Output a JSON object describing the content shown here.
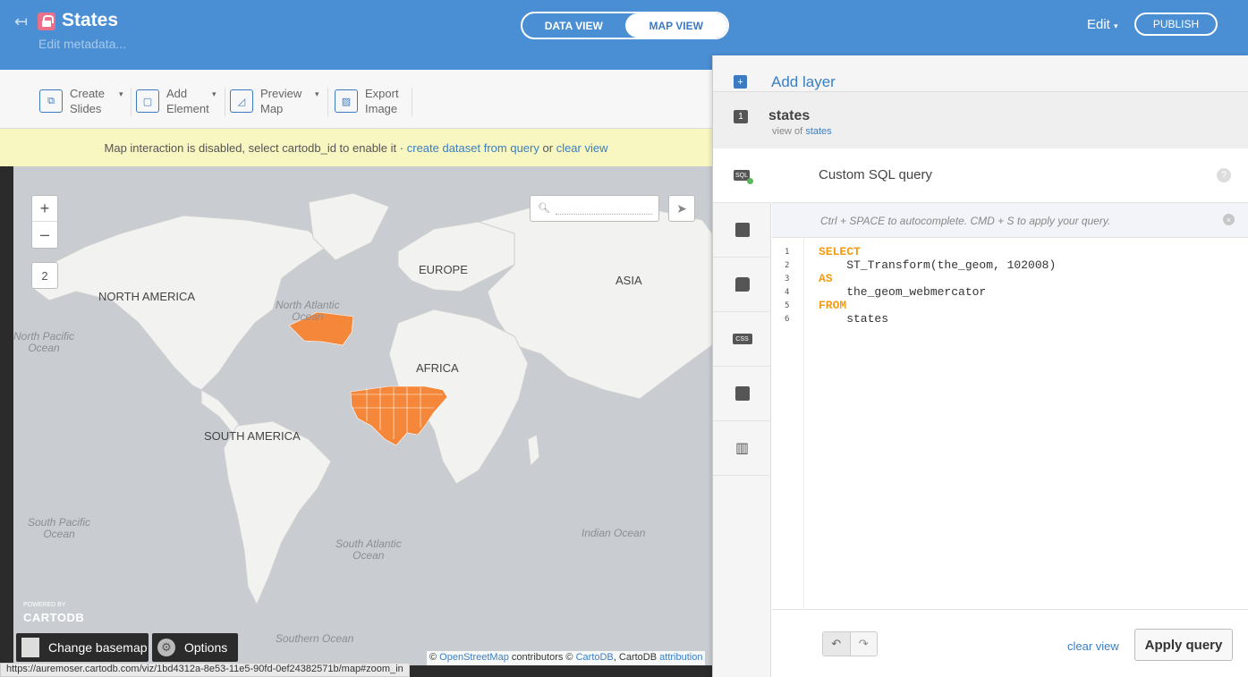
{
  "header": {
    "back_icon": "back-arrow-icon",
    "lock_icon": "lock-icon",
    "title": "States",
    "edit_metadata": "Edit metadata...",
    "view_toggle": [
      {
        "label": "DATA VIEW",
        "active": false
      },
      {
        "label": "MAP VIEW",
        "active": true
      }
    ],
    "edit_label": "Edit",
    "publish_label": "PUBLISH",
    "bg_color": "#4a8ed3"
  },
  "toolbar": {
    "items": [
      {
        "line1": "Create",
        "line2": "Slides",
        "icon": "slides-icon"
      },
      {
        "line1": "Add",
        "line2": "Element",
        "icon": "element-icon"
      },
      {
        "line1": "Preview",
        "line2": "Map",
        "icon": "preview-icon"
      },
      {
        "line1": "Export",
        "line2": "Image",
        "icon": "image-icon"
      }
    ]
  },
  "notice": {
    "text": "Map interaction is disabled, select cartodb_id to enable it ·",
    "link1": "create dataset from query",
    "or": "or",
    "link2": "clear view"
  },
  "map": {
    "zoom_in": "+",
    "zoom_out": "–",
    "zoom_level": "2",
    "labels": {
      "north_america": "NORTH AMERICA",
      "europe": "EUROPE",
      "asia": "ASIA",
      "africa": "AFRICA",
      "south_america": "SOUTH AMERICA",
      "north_atlantic_1": "North Atlantic",
      "north_atlantic_2": "Ocean",
      "north_pacific_1": "North Pacific",
      "north_pacific_2": "Ocean",
      "south_pacific_1": "South Pacific",
      "south_pacific_2": "Ocean",
      "south_atlantic_1": "South Atlantic",
      "south_atlantic_2": "Ocean",
      "indian_ocean": "Indian Ocean",
      "southern_ocean": "Southern Ocean"
    },
    "powered_by": "POWERED BY",
    "logo": "CARTODB",
    "change_basemap": "Change basemap",
    "options": "Options",
    "attribution": {
      "prefix": "©",
      "osm": "OpenStreetMap",
      "contributors": "contributors ©",
      "cartodb": "CartoDB",
      "sep": ", CartoDB",
      "attr": "attribution"
    },
    "highlight_color": "#f5873a"
  },
  "status_url": "https://auremoser.cartodb.com/viz/1bd4312a-8e53-11e5-90fd-0ef24382571b/map#zoom_in",
  "panel": {
    "add_layer": "Add layer",
    "layer_number": "1",
    "layer_name": "states",
    "view_of": "view of",
    "view_of_link": "states",
    "tools": [
      "sql-icon",
      "wizard-icon",
      "infowindow-icon",
      "css-icon",
      "legend-icon",
      "chart-icon"
    ],
    "sql_badge": "SQL",
    "css_badge": "CSS",
    "sql_title": "Custom SQL query",
    "help": "?",
    "hint": "Ctrl + SPACE to autocomplete. CMD + S to apply your query.",
    "hint_close": "×",
    "code_lines": [
      {
        "n": "1",
        "text": "SELECT",
        "kw": true
      },
      {
        "n": "2",
        "text": "    ST_Transform(the_geom, 102008)",
        "kw": false
      },
      {
        "n": "3",
        "text": "AS",
        "kw": true
      },
      {
        "n": "4",
        "text": "    the_geom_webmercator",
        "kw": false
      },
      {
        "n": "5",
        "text": "FROM",
        "kw": true
      },
      {
        "n": "6",
        "text": "    states",
        "kw": false
      }
    ],
    "undo": "↶",
    "redo": "↷",
    "clear_view": "clear view",
    "apply_query": "Apply query",
    "keyword_color": "#f39c12"
  }
}
